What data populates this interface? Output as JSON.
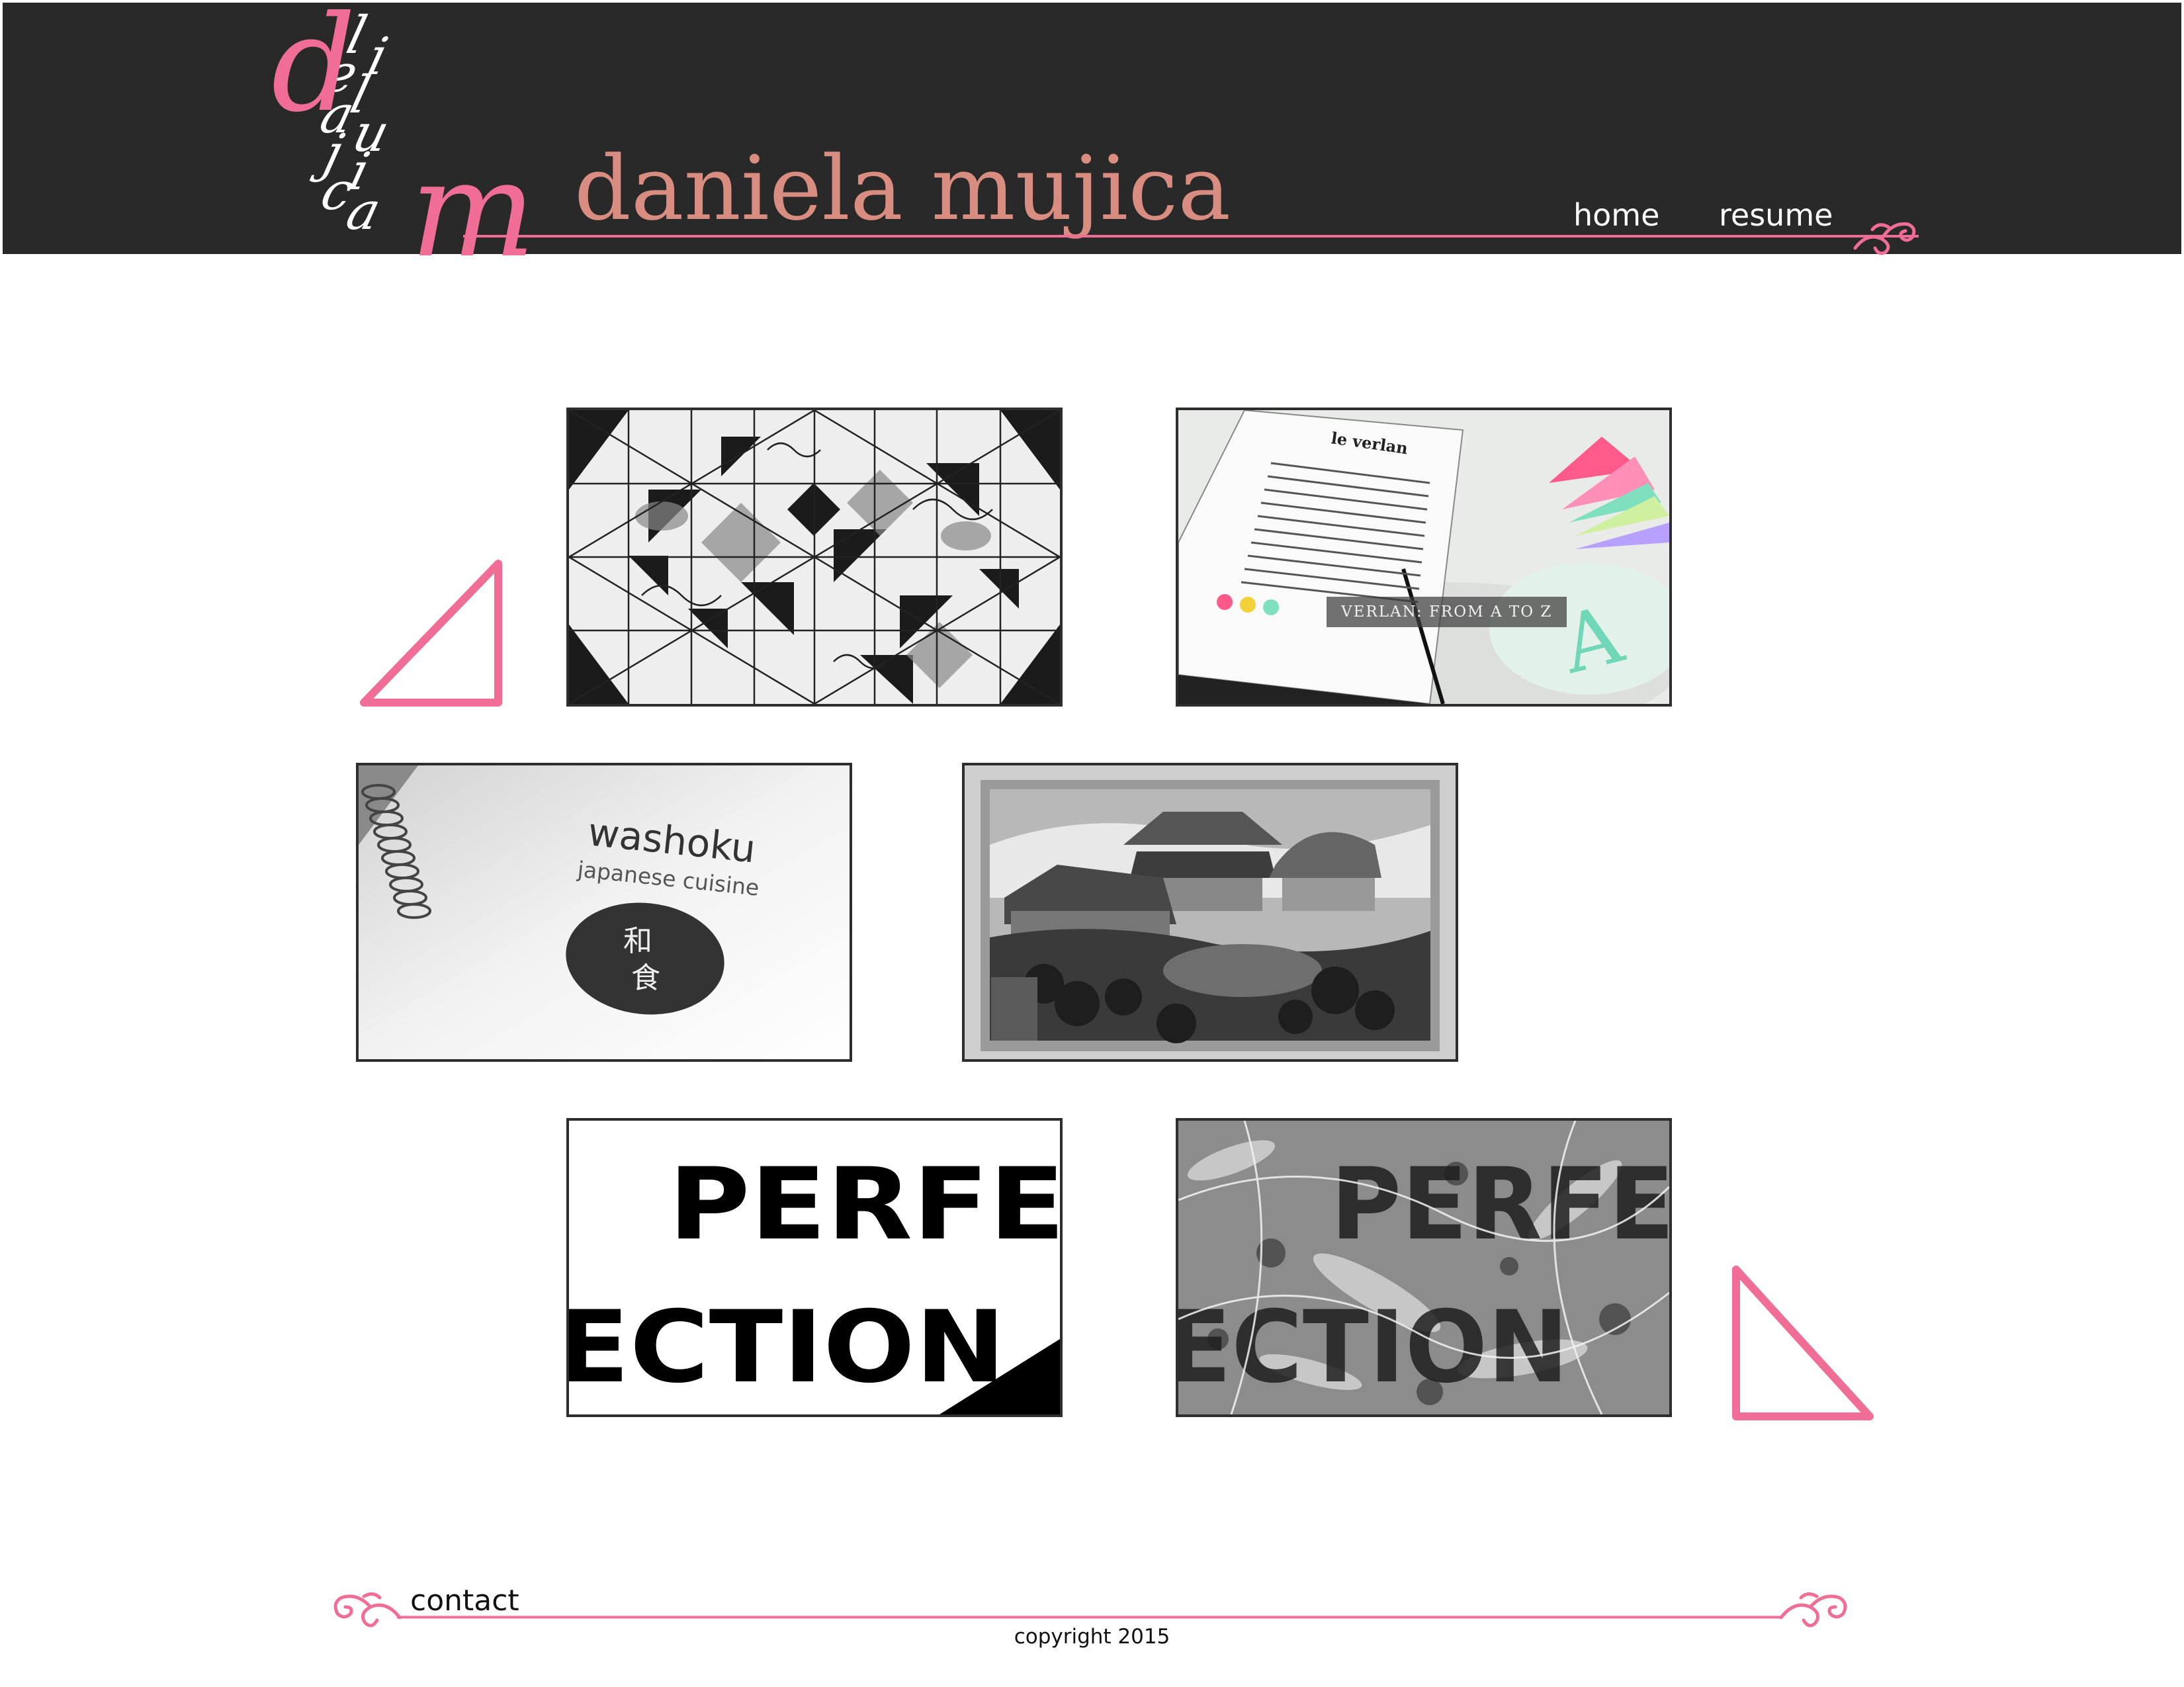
{
  "theme": {
    "header_bg": "#2a2929",
    "accent_pink": "#f06e96",
    "title_color": "#d98c80"
  },
  "header": {
    "logo_letters": {
      "first": "d",
      "last": "m"
    },
    "logo_stack_letters": [
      "l",
      "i",
      "e",
      "l",
      "a",
      "u",
      "j",
      "i",
      "c",
      "a"
    ],
    "site_title": "daniela mujica",
    "nav": {
      "home": "home",
      "resume": "resume"
    }
  },
  "gallery": {
    "items": [
      {
        "name": "geometric ink drawing",
        "caption": ""
      },
      {
        "name": "verlan book",
        "caption": "VERLAN: FROM A TO Z",
        "inner_text": {
          "heading": "le verlan",
          "letter": "A"
        }
      },
      {
        "name": "washoku menu",
        "caption": "",
        "inner_text": {
          "title": "washoku",
          "subtitle": "japanese cuisine",
          "kanji_1": "和",
          "kanji_2": "食"
        }
      },
      {
        "name": "japanese village diorama",
        "caption": ""
      },
      {
        "name": "perfection typography",
        "caption": "",
        "inner_text": {
          "line1": "PERFE",
          "line2": "ECTION"
        }
      },
      {
        "name": "perfection splatter",
        "caption": "",
        "inner_text": {
          "line1": "PERFE",
          "line2": "ECTION"
        }
      }
    ]
  },
  "footer": {
    "contact": "contact",
    "copyright": "copyright 2015"
  }
}
